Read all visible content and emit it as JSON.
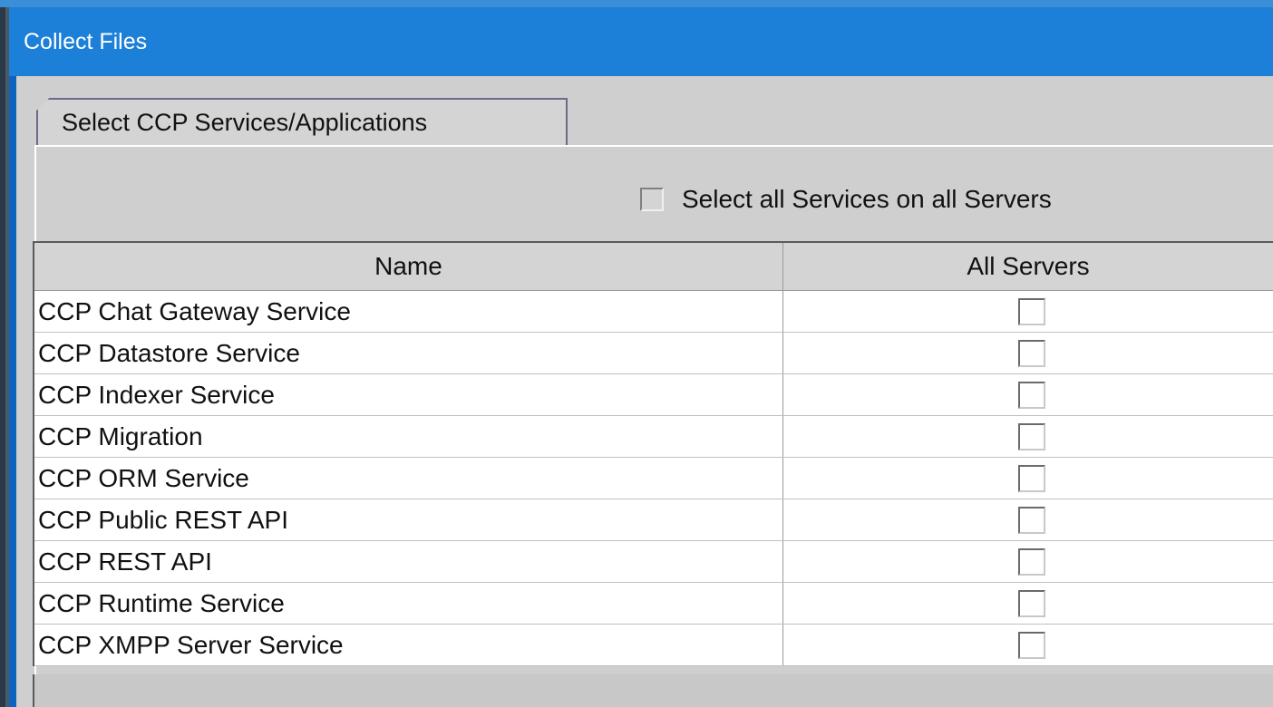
{
  "window": {
    "title": "Collect Files"
  },
  "tab": {
    "label": "Select CCP Services/Applications"
  },
  "select_all": {
    "label": "Select all Services on all Servers",
    "checked": false
  },
  "table": {
    "columns": [
      "Name",
      "All Servers"
    ],
    "rows": [
      {
        "name": "CCP Chat Gateway Service",
        "all_servers": false
      },
      {
        "name": "CCP Datastore Service",
        "all_servers": false
      },
      {
        "name": "CCP Indexer Service",
        "all_servers": false
      },
      {
        "name": "CCP Migration",
        "all_servers": false
      },
      {
        "name": "CCP ORM Service",
        "all_servers": false
      },
      {
        "name": "CCP Public REST API",
        "all_servers": false
      },
      {
        "name": "CCP REST API",
        "all_servers": false
      },
      {
        "name": "CCP Runtime Service",
        "all_servers": false
      },
      {
        "name": "CCP XMPP Server Service",
        "all_servers": false
      }
    ]
  },
  "colors": {
    "titlebar": "#1c7fd8",
    "panel": "#cfcfcf"
  }
}
